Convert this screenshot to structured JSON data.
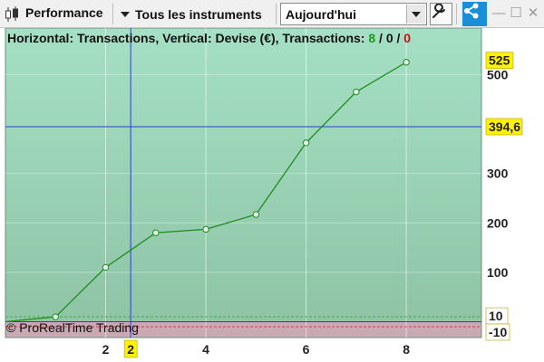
{
  "toolbar": {
    "title": "Performance",
    "instrument_label": "Tous les instruments",
    "period_value": "Aujourd'hui"
  },
  "header": {
    "prefix": "Horizontal: Transactions, Vertical: Devise (€), Transactions: ",
    "win_count": "8",
    "sep1": " / ",
    "neutral_count": "0",
    "sep2": " / ",
    "loss_count": "0"
  },
  "watermark": "© ProRealTime Trading",
  "markers": {
    "last_value": "525",
    "cursor_value": "394,6",
    "cursor_x": "2",
    "upper_band": "10",
    "lower_band": "-10"
  },
  "colors": {
    "profit_fill_top": "#a5e0c4",
    "profit_fill_bottom": "#8fc4a6",
    "loss_fill": "#c9a9b3",
    "line": "#1e8c1e",
    "crosshair": "#2a3fd0",
    "win_text": "#1a9a1a",
    "loss_text": "#c01010",
    "marker_bg": "#fff200"
  },
  "chart_data": {
    "type": "line",
    "title": "",
    "xlabel": "Transactions",
    "ylabel": "Devise (€)",
    "x": [
      0,
      1,
      2,
      3,
      4,
      5,
      6,
      7,
      8
    ],
    "series": [
      {
        "values": [
          0,
          10,
          110,
          180,
          187,
          217,
          362,
          465,
          525
        ]
      }
    ],
    "x_ticks": [
      "2",
      "4",
      "6",
      "8"
    ],
    "y_ticks": [
      "100",
      "200",
      "300",
      "500"
    ],
    "xlim": [
      0,
      9.5
    ],
    "ylim": [
      -32,
      552
    ],
    "grid": true,
    "crosshair": {
      "x": 2.5,
      "y": 394.6
    }
  }
}
